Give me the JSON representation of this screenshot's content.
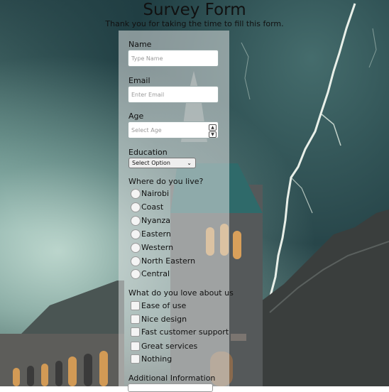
{
  "header": {
    "title": "Survey Form",
    "subtitle": "Thank you for taking the time to fill this form."
  },
  "form": {
    "name": {
      "label": "Name",
      "placeholder": "Type Name"
    },
    "email": {
      "label": "Email",
      "placeholder": "Enter Email"
    },
    "age": {
      "label": "Age",
      "placeholder": "Select Age"
    },
    "education": {
      "label": "Education",
      "selected": "Select Option"
    },
    "location": {
      "label": "Where do you live?",
      "options": [
        "Nairobi",
        "Coast",
        "Nyanza",
        "Eastern",
        "Western",
        "North Eastern",
        "Central"
      ]
    },
    "love": {
      "label": "What do you love about us",
      "options": [
        "Ease of use",
        "Nice design",
        "Fast customer support",
        "Great services",
        "Nothing"
      ]
    },
    "additional": {
      "label": "Additional Information"
    }
  },
  "icons": {
    "spin_up": "chevron-up-icon",
    "spin_down": "chevron-down-icon",
    "select_caret": "chevron-down-icon"
  }
}
